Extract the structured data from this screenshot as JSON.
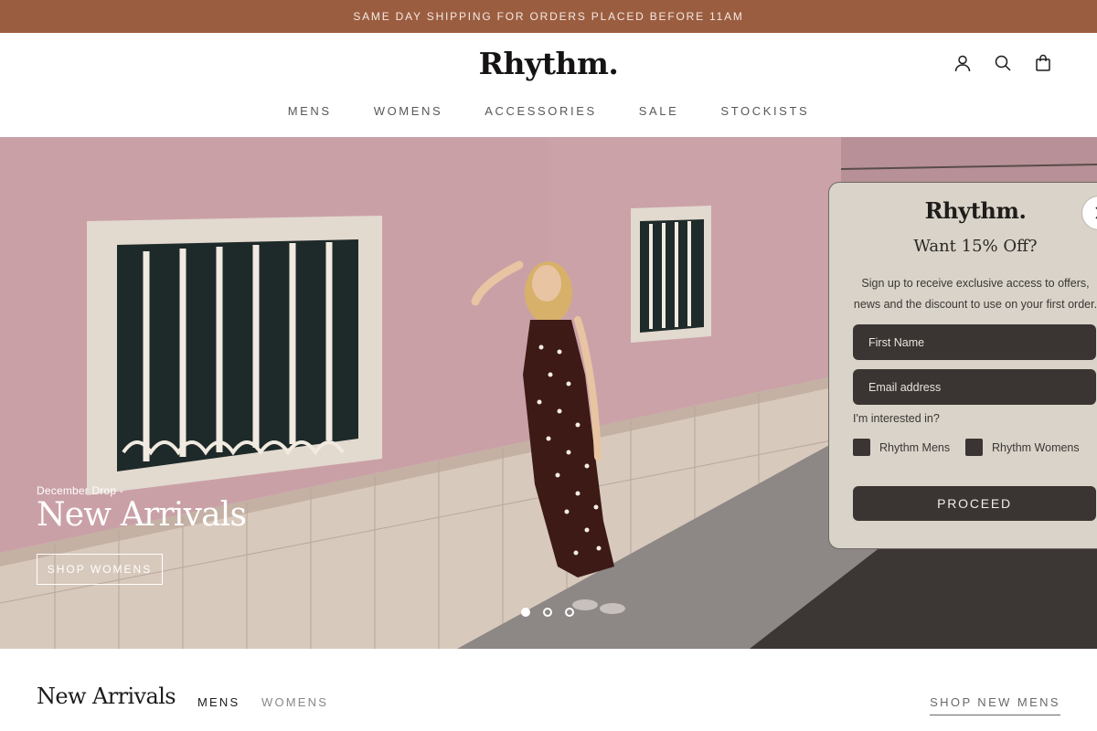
{
  "announcement": "SAME DAY SHIPPING FOR ORDERS PLACED BEFORE 11AM",
  "header": {
    "logo": "Rhythm.",
    "icons": [
      "account-icon",
      "search-icon",
      "bag-icon"
    ]
  },
  "nav": {
    "items": [
      {
        "label": "MENS"
      },
      {
        "label": "WOMENS"
      },
      {
        "label": "ACCESSORIES"
      },
      {
        "label": "SALE"
      },
      {
        "label": "STOCKISTS"
      }
    ]
  },
  "hero": {
    "subtitle": "December Drop -",
    "title": "New Arrivals",
    "button": "SHOP WOMENS",
    "slides_total": 3,
    "active_slide": 1
  },
  "popup": {
    "logo": "Rhythm.",
    "heading": "Want 15% Off?",
    "text": "Sign up to receive exclusive access to offers, news and the discount to use on your first order.",
    "first_name_placeholder": "First Name",
    "email_placeholder": "Email address",
    "question": "I'm interested in?",
    "options": [
      {
        "label": "Rhythm Mens",
        "checked": false
      },
      {
        "label": "Rhythm Womens",
        "checked": false
      }
    ],
    "submit": "PROCEED"
  },
  "new_arrivals": {
    "title": "New Arrivals",
    "tabs": [
      {
        "label": "MENS",
        "active": true
      },
      {
        "label": "WOMENS",
        "active": false
      }
    ],
    "link": "SHOP NEW MENS"
  },
  "colors": {
    "announcement_bg": "#9b5d40",
    "popup_bg": "#d9d3c9",
    "field_bg": "#3a3532"
  }
}
